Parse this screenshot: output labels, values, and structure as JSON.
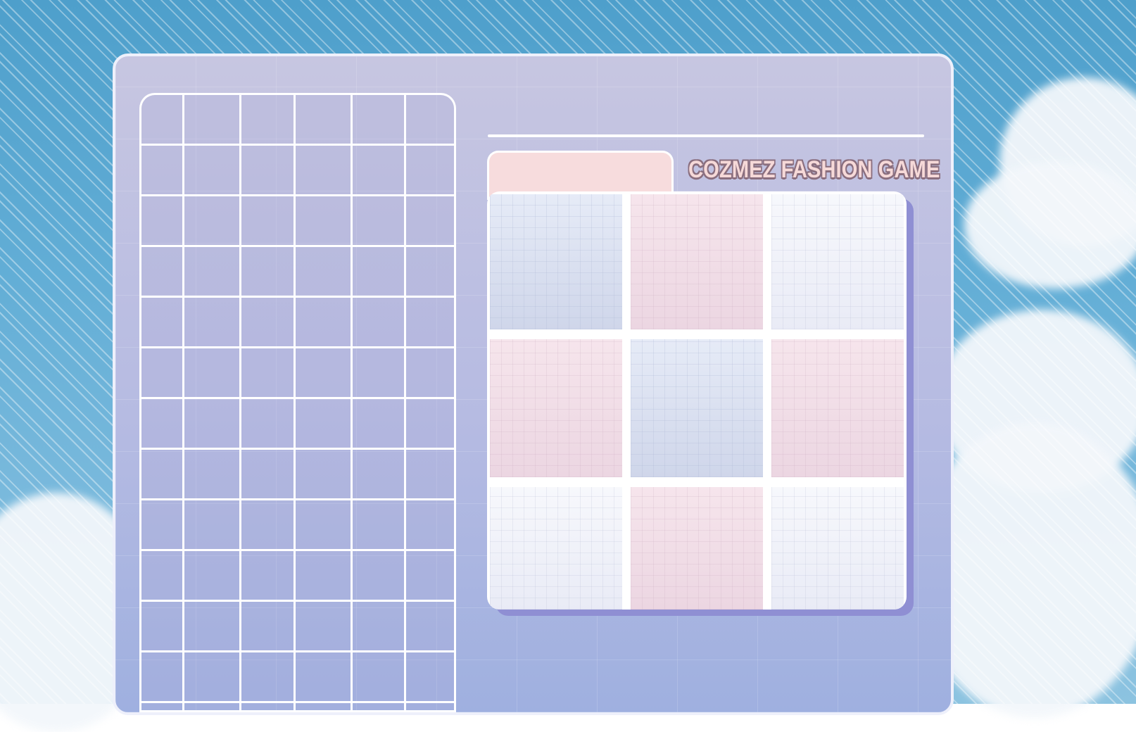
{
  "game": {
    "title": "COZMEZ FASHION GAME"
  },
  "inventory": {
    "columns": 6,
    "rows": 13
  },
  "outfit_grid": {
    "cells": [
      {
        "tint": "blue"
      },
      {
        "tint": "pink"
      },
      {
        "tint": "white"
      },
      {
        "tint": "pink"
      },
      {
        "tint": "blue"
      },
      {
        "tint": "pink"
      },
      {
        "tint": "white"
      },
      {
        "tint": "pink"
      },
      {
        "tint": "white"
      }
    ]
  },
  "colors": {
    "sky": "#5ea9d2",
    "board": "#b9bde2",
    "tab": "#f7dcdd",
    "title_fill": "#f6d9d8",
    "title_outline": "#8a6e7e",
    "panel_shadow": "#8f8fd3"
  }
}
